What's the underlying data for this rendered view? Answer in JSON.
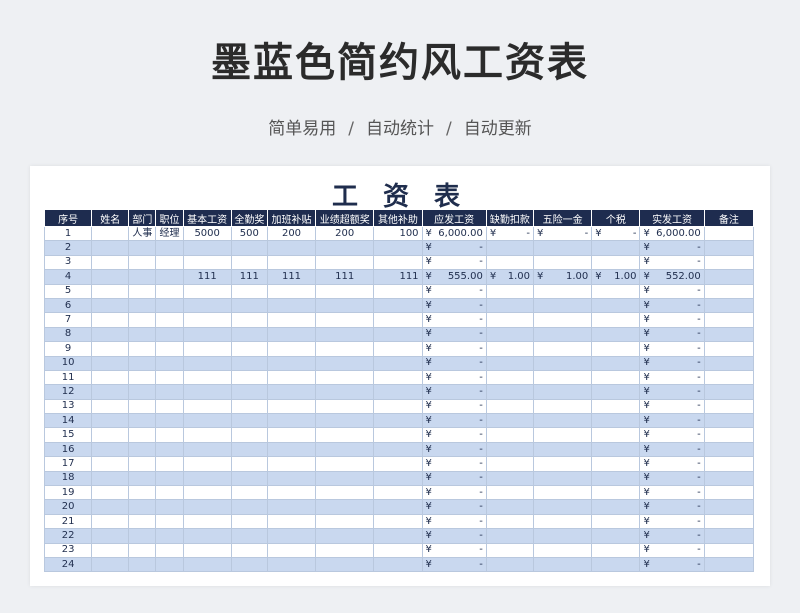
{
  "page": {
    "title": "墨蓝色简约风工资表",
    "tags": [
      "简单易用",
      "自动统计",
      "自动更新"
    ],
    "tag_separator": "/"
  },
  "sheet": {
    "title": "工 资 表",
    "currency_symbol": "¥",
    "headers": [
      "序号",
      "姓名",
      "部门",
      "职位",
      "基本工资",
      "全勤奖",
      "加班补贴",
      "业绩超额奖",
      "其他补助",
      "应发工资",
      "缺勤扣款",
      "五险一金",
      "个税",
      "实发工资",
      "备注"
    ],
    "rows": [
      {
        "no": "1",
        "name": "",
        "dept": "人事",
        "position": "经理",
        "base": "5000",
        "attendance": "500",
        "overtime": "200",
        "performance": "200",
        "other": "100",
        "gross": "6,000.00",
        "absence": "-",
        "insurance": "-",
        "tax": "-",
        "net": "6,000.00",
        "remark": ""
      },
      {
        "no": "2",
        "name": "",
        "dept": "",
        "position": "",
        "base": "",
        "attendance": "",
        "overtime": "",
        "performance": "",
        "other": "",
        "gross": "-",
        "absence": "",
        "insurance": "",
        "tax": "",
        "net": "-",
        "remark": ""
      },
      {
        "no": "3",
        "name": "",
        "dept": "",
        "position": "",
        "base": "",
        "attendance": "",
        "overtime": "",
        "performance": "",
        "other": "",
        "gross": "-",
        "absence": "",
        "insurance": "",
        "tax": "",
        "net": "-",
        "remark": ""
      },
      {
        "no": "4",
        "name": "",
        "dept": "",
        "position": "",
        "base": "111",
        "attendance": "111",
        "overtime": "111",
        "performance": "111",
        "other": "111",
        "gross": "555.00",
        "absence": "1.00",
        "insurance": "1.00",
        "tax": "1.00",
        "net": "552.00",
        "remark": ""
      },
      {
        "no": "5",
        "name": "",
        "dept": "",
        "position": "",
        "base": "",
        "attendance": "",
        "overtime": "",
        "performance": "",
        "other": "",
        "gross": "-",
        "absence": "",
        "insurance": "",
        "tax": "",
        "net": "-",
        "remark": ""
      },
      {
        "no": "6",
        "name": "",
        "dept": "",
        "position": "",
        "base": "",
        "attendance": "",
        "overtime": "",
        "performance": "",
        "other": "",
        "gross": "-",
        "absence": "",
        "insurance": "",
        "tax": "",
        "net": "-",
        "remark": ""
      },
      {
        "no": "7",
        "name": "",
        "dept": "",
        "position": "",
        "base": "",
        "attendance": "",
        "overtime": "",
        "performance": "",
        "other": "",
        "gross": "-",
        "absence": "",
        "insurance": "",
        "tax": "",
        "net": "-",
        "remark": ""
      },
      {
        "no": "8",
        "name": "",
        "dept": "",
        "position": "",
        "base": "",
        "attendance": "",
        "overtime": "",
        "performance": "",
        "other": "",
        "gross": "-",
        "absence": "",
        "insurance": "",
        "tax": "",
        "net": "-",
        "remark": ""
      },
      {
        "no": "9",
        "name": "",
        "dept": "",
        "position": "",
        "base": "",
        "attendance": "",
        "overtime": "",
        "performance": "",
        "other": "",
        "gross": "-",
        "absence": "",
        "insurance": "",
        "tax": "",
        "net": "-",
        "remark": ""
      },
      {
        "no": "10",
        "name": "",
        "dept": "",
        "position": "",
        "base": "",
        "attendance": "",
        "overtime": "",
        "performance": "",
        "other": "",
        "gross": "-",
        "absence": "",
        "insurance": "",
        "tax": "",
        "net": "-",
        "remark": ""
      },
      {
        "no": "11",
        "name": "",
        "dept": "",
        "position": "",
        "base": "",
        "attendance": "",
        "overtime": "",
        "performance": "",
        "other": "",
        "gross": "-",
        "absence": "",
        "insurance": "",
        "tax": "",
        "net": "-",
        "remark": ""
      },
      {
        "no": "12",
        "name": "",
        "dept": "",
        "position": "",
        "base": "",
        "attendance": "",
        "overtime": "",
        "performance": "",
        "other": "",
        "gross": "-",
        "absence": "",
        "insurance": "",
        "tax": "",
        "net": "-",
        "remark": ""
      },
      {
        "no": "13",
        "name": "",
        "dept": "",
        "position": "",
        "base": "",
        "attendance": "",
        "overtime": "",
        "performance": "",
        "other": "",
        "gross": "-",
        "absence": "",
        "insurance": "",
        "tax": "",
        "net": "-",
        "remark": ""
      },
      {
        "no": "14",
        "name": "",
        "dept": "",
        "position": "",
        "base": "",
        "attendance": "",
        "overtime": "",
        "performance": "",
        "other": "",
        "gross": "-",
        "absence": "",
        "insurance": "",
        "tax": "",
        "net": "-",
        "remark": ""
      },
      {
        "no": "15",
        "name": "",
        "dept": "",
        "position": "",
        "base": "",
        "attendance": "",
        "overtime": "",
        "performance": "",
        "other": "",
        "gross": "-",
        "absence": "",
        "insurance": "",
        "tax": "",
        "net": "-",
        "remark": ""
      },
      {
        "no": "16",
        "name": "",
        "dept": "",
        "position": "",
        "base": "",
        "attendance": "",
        "overtime": "",
        "performance": "",
        "other": "",
        "gross": "-",
        "absence": "",
        "insurance": "",
        "tax": "",
        "net": "-",
        "remark": ""
      },
      {
        "no": "17",
        "name": "",
        "dept": "",
        "position": "",
        "base": "",
        "attendance": "",
        "overtime": "",
        "performance": "",
        "other": "",
        "gross": "-",
        "absence": "",
        "insurance": "",
        "tax": "",
        "net": "-",
        "remark": ""
      },
      {
        "no": "18",
        "name": "",
        "dept": "",
        "position": "",
        "base": "",
        "attendance": "",
        "overtime": "",
        "performance": "",
        "other": "",
        "gross": "-",
        "absence": "",
        "insurance": "",
        "tax": "",
        "net": "-",
        "remark": ""
      },
      {
        "no": "19",
        "name": "",
        "dept": "",
        "position": "",
        "base": "",
        "attendance": "",
        "overtime": "",
        "performance": "",
        "other": "",
        "gross": "-",
        "absence": "",
        "insurance": "",
        "tax": "",
        "net": "-",
        "remark": ""
      },
      {
        "no": "20",
        "name": "",
        "dept": "",
        "position": "",
        "base": "",
        "attendance": "",
        "overtime": "",
        "performance": "",
        "other": "",
        "gross": "-",
        "absence": "",
        "insurance": "",
        "tax": "",
        "net": "-",
        "remark": ""
      },
      {
        "no": "21",
        "name": "",
        "dept": "",
        "position": "",
        "base": "",
        "attendance": "",
        "overtime": "",
        "performance": "",
        "other": "",
        "gross": "-",
        "absence": "",
        "insurance": "",
        "tax": "",
        "net": "-",
        "remark": ""
      },
      {
        "no": "22",
        "name": "",
        "dept": "",
        "position": "",
        "base": "",
        "attendance": "",
        "overtime": "",
        "performance": "",
        "other": "",
        "gross": "-",
        "absence": "",
        "insurance": "",
        "tax": "",
        "net": "-",
        "remark": ""
      },
      {
        "no": "23",
        "name": "",
        "dept": "",
        "position": "",
        "base": "",
        "attendance": "",
        "overtime": "",
        "performance": "",
        "other": "",
        "gross": "-",
        "absence": "",
        "insurance": "",
        "tax": "",
        "net": "-",
        "remark": ""
      },
      {
        "no": "24",
        "name": "",
        "dept": "",
        "position": "",
        "base": "",
        "attendance": "",
        "overtime": "",
        "performance": "",
        "other": "",
        "gross": "-",
        "absence": "",
        "insurance": "",
        "tax": "",
        "net": "-",
        "remark": ""
      }
    ]
  }
}
